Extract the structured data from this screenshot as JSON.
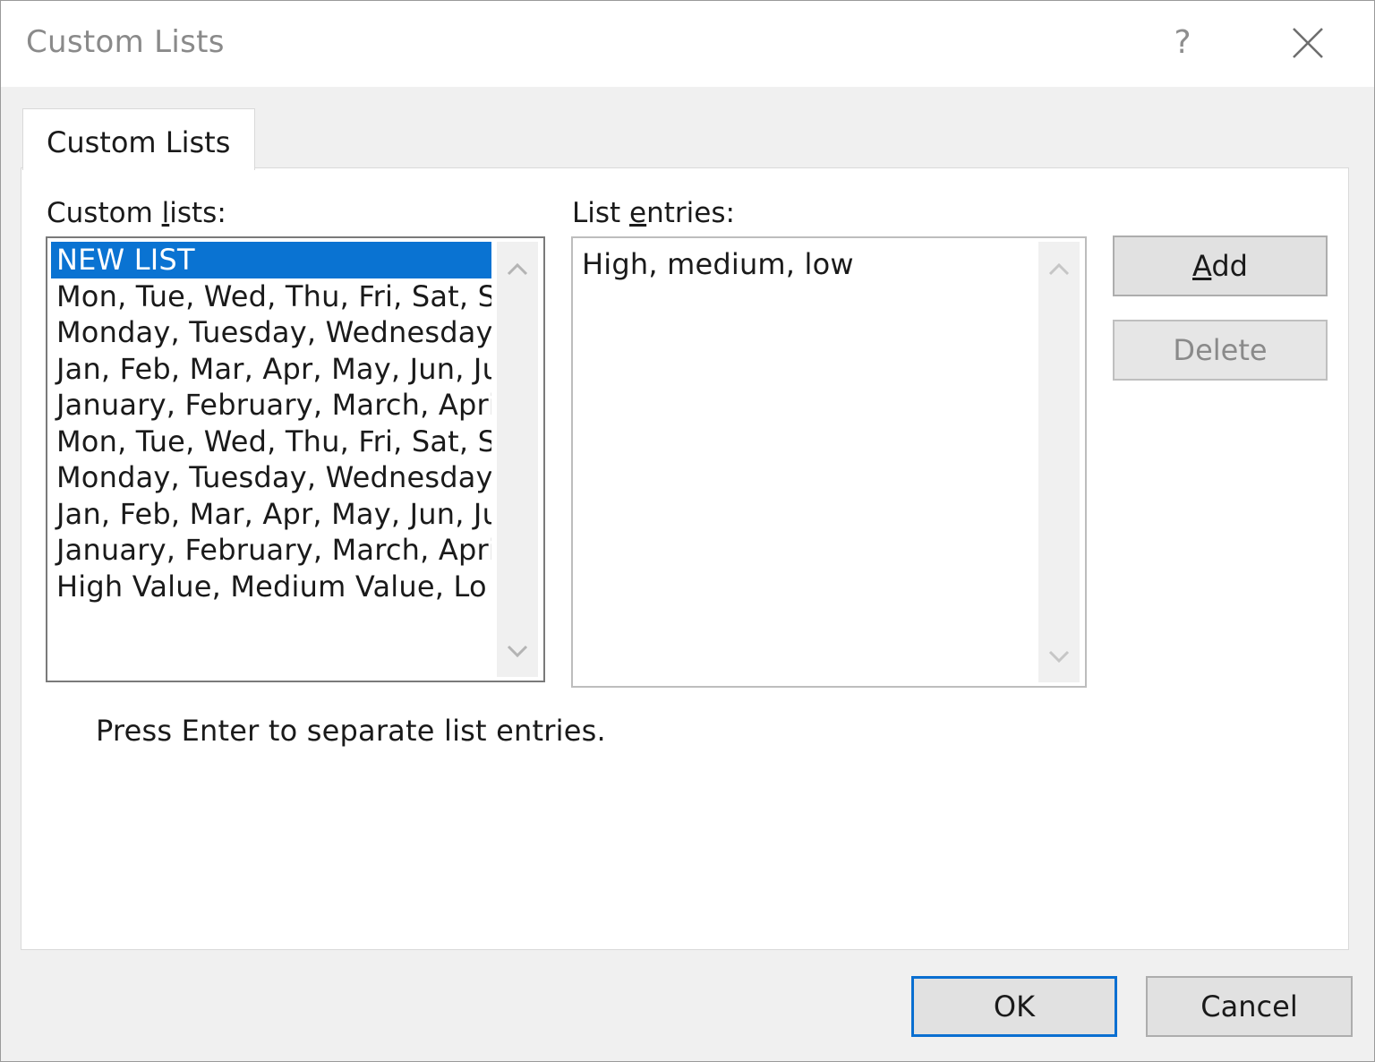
{
  "window": {
    "title": "Custom Lists",
    "help_label": "?"
  },
  "tabs": [
    {
      "label": "Custom Lists",
      "active": true
    }
  ],
  "custom_lists": {
    "label_pre": "Custom ",
    "label_accel": "l",
    "label_post": "ists:",
    "items": [
      "NEW LIST",
      "Mon, Tue, Wed, Thu, Fri, Sat, S",
      "Monday, Tuesday, Wednesday",
      "Jan, Feb, Mar, Apr, May, Jun, Ju",
      "January, February, March, Apri",
      "Mon, Tue, Wed, Thu, Fri, Sat, S",
      "Monday, Tuesday, Wednesday",
      "Jan, Feb, Mar, Apr, May, Jun, Ju",
      "January, February, March, Apri",
      "High Value, Medium Value, Lo"
    ],
    "selected_index": 0
  },
  "list_entries": {
    "label_pre": "List ",
    "label_accel": "e",
    "label_post": "ntries:",
    "value": "High, medium, low"
  },
  "buttons": {
    "add_accel": "A",
    "add_rest": "dd",
    "delete_label": "Delete",
    "ok_label": "OK",
    "cancel_label": "Cancel"
  },
  "hint_text": "Press Enter to separate list entries.",
  "colors": {
    "selection": "#0a73d2",
    "default_button_border": "#0a6fd1",
    "dialog_background": "#f0f0f0"
  }
}
